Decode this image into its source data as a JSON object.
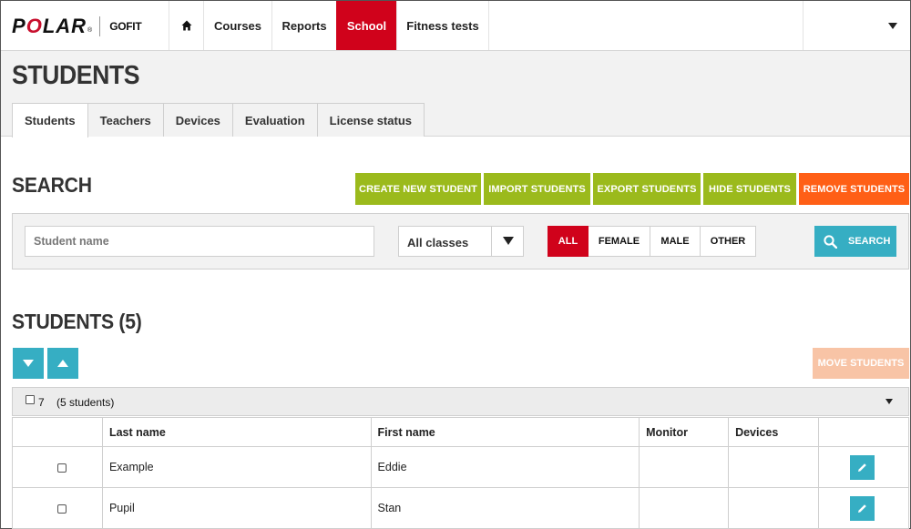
{
  "brand": {
    "name": "POLAR",
    "product": "GOFIT"
  },
  "nav": {
    "items": [
      {
        "label": "Courses"
      },
      {
        "label": "Reports"
      },
      {
        "label": "School"
      },
      {
        "label": "Fitness tests"
      }
    ],
    "active": "School"
  },
  "page": {
    "title": "STUDENTS",
    "tabs": [
      {
        "label": "Students"
      },
      {
        "label": "Teachers"
      },
      {
        "label": "Devices"
      },
      {
        "label": "Evaluation"
      },
      {
        "label": "License status"
      }
    ],
    "active_tab": "Students"
  },
  "search": {
    "title": "SEARCH",
    "actions": {
      "create": "CREATE NEW STUDENT",
      "import": "IMPORT STUDENTS",
      "export": "EXPORT STUDENTS",
      "hide": "HIDE STUDENTS",
      "remove": "REMOVE STUDENTS"
    },
    "name_placeholder": "Student name",
    "class_select": "All classes",
    "gender": {
      "all": "ALL",
      "female": "FEMALE",
      "male": "MALE",
      "other": "OTHER"
    },
    "gender_selected": "ALL",
    "button": "SEARCH"
  },
  "list": {
    "title": "STUDENTS (5)",
    "move_button": "MOVE STUDENTS",
    "group": {
      "class": "7",
      "count": "(5 students)"
    },
    "columns": {
      "last_name": "Last name",
      "first_name": "First name",
      "monitor": "Monitor",
      "devices": "Devices"
    },
    "rows": [
      {
        "last_name": "Example",
        "first_name": "Eddie",
        "monitor": "",
        "devices": ""
      },
      {
        "last_name": "Pupil",
        "first_name": "Stan",
        "monitor": "",
        "devices": ""
      }
    ]
  },
  "colors": {
    "accent_red": "#d0021b",
    "action_green": "#9bba1c",
    "action_orange": "#ff5f16",
    "teal": "#36aec3",
    "disabled_peach": "#f8c4a6"
  }
}
